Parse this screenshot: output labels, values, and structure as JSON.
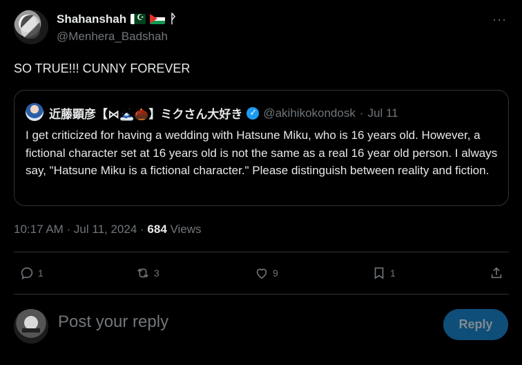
{
  "author": {
    "display_name": "Shahanshah",
    "extra_glyph": "ᚹ",
    "handle": "@Menhera_Badshah"
  },
  "more_label": "···",
  "tweet_text": "SO TRUE!!! CUNNY FOREVER",
  "quote": {
    "display_name": "近藤顕彦【⋈🗻🌰】ミクさん大好き",
    "handle": "@akihikokondosk",
    "separator": "·",
    "date": "Jul 11",
    "text": "I get criticized for having a wedding with Hatsune Miku, who is 16 years old. However, a fictional character set at 16 years old is not the same as a real 16 year old person. I always say, \"Hatsune Miku is a fictional character.\" Please distinguish between reality and fiction."
  },
  "timestamp": {
    "time": "10:17 AM · Jul 11, 2024 · ",
    "views_count": "684",
    "views_label": " Views"
  },
  "actions": {
    "replies": "1",
    "reposts": "3",
    "likes": "9",
    "bookmarks": "1"
  },
  "reply_box": {
    "placeholder": "Post your reply",
    "button_label": "Reply"
  },
  "icons": [
    "reply-icon",
    "repost-icon",
    "like-icon",
    "bookmark-icon",
    "share-icon",
    "verified-icon",
    "more-icon"
  ],
  "colors": {
    "background": "#000000",
    "text": "#e7e9ea",
    "muted": "#71767b",
    "border": "#2f3336",
    "accent": "#1d9bf0",
    "reply_button_disabled": "#0f4e78"
  }
}
